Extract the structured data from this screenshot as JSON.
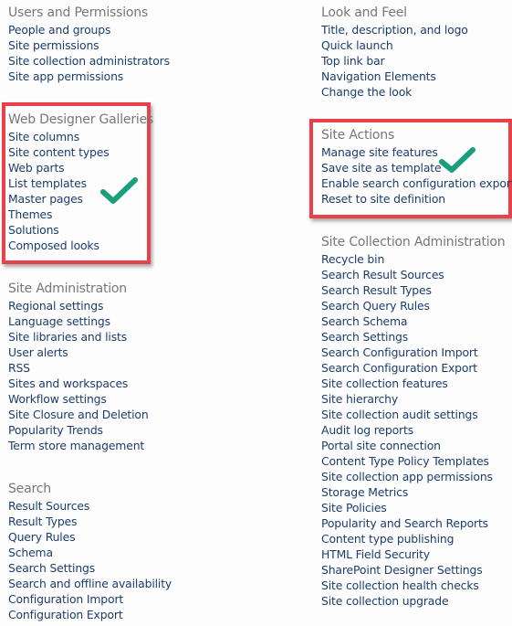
{
  "colors": {
    "heading": "#777777",
    "link": "#1c3d6e",
    "highlight": "#e84149",
    "check": "#1a9f7c"
  },
  "sections": {
    "users_permissions": {
      "title": "Users and Permissions",
      "items": [
        "People and groups",
        "Site permissions",
        "Site collection administrators",
        "Site app permissions"
      ]
    },
    "web_designer_galleries": {
      "title": "Web Designer Galleries",
      "items": [
        "Site columns",
        "Site content types",
        "Web parts",
        "List templates",
        "Master pages",
        "Themes",
        "Solutions",
        "Composed looks"
      ]
    },
    "site_administration": {
      "title": "Site Administration",
      "items": [
        "Regional settings",
        "Language settings",
        "Site libraries and lists",
        "User alerts",
        "RSS",
        "Sites and workspaces",
        "Workflow settings",
        "Site Closure and Deletion",
        "Popularity Trends",
        "Term store management"
      ]
    },
    "search": {
      "title": "Search",
      "items": [
        "Result Sources",
        "Result Types",
        "Query Rules",
        "Schema",
        "Search Settings",
        "Search and offline availability",
        "Configuration Import",
        "Configuration Export"
      ]
    },
    "look_and_feel": {
      "title": "Look and Feel",
      "items": [
        "Title, description, and logo",
        "Quick launch",
        "Top link bar",
        "Navigation Elements",
        "Change the look"
      ]
    },
    "site_actions": {
      "title": "Site Actions",
      "items": [
        "Manage site features",
        "Save site as template",
        "Enable search configuration export",
        "Reset to site definition"
      ]
    },
    "site_collection_administration": {
      "title": "Site Collection Administration",
      "items": [
        "Recycle bin",
        "Search Result Sources",
        "Search Result Types",
        "Search Query Rules",
        "Search Schema",
        "Search Settings",
        "Search Configuration Import",
        "Search Configuration Export",
        "Site collection features",
        "Site hierarchy",
        "Site collection audit settings",
        "Audit log reports",
        "Portal site connection",
        "Content Type Policy Templates",
        "Site collection app permissions",
        "Storage Metrics",
        "Site Policies",
        "Popularity and Search Reports",
        "Content type publishing",
        "HTML Field Security",
        "SharePoint Designer Settings",
        "Site collection health checks",
        "Site collection upgrade"
      ]
    }
  },
  "annotations": {
    "highlighted_sections": [
      "web_designer_galleries",
      "site_actions"
    ],
    "checkmark_icon": "check-icon"
  }
}
